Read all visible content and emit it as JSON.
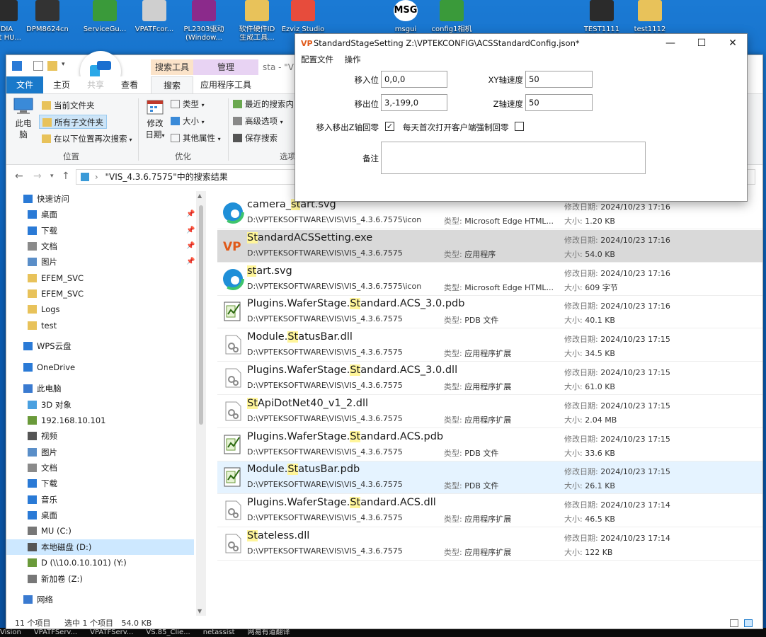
{
  "desktop": {
    "icons": [
      {
        "label": "IDIA",
        "label2": "ont HU...",
        "color": "#2b2b2b"
      },
      {
        "label": "DPM8624cn",
        "label2": "",
        "color": "#333"
      },
      {
        "label": "ServiceGu...",
        "label2": "",
        "color": "#3a9a3a"
      },
      {
        "label": "VPATFcor...",
        "label2": "",
        "color": "#cfcfcf"
      },
      {
        "label": "PL2303驱动",
        "label2": "(Window...",
        "color": "#8b2a8b"
      },
      {
        "label": "软件硬件ID",
        "label2": "生成工具...",
        "color": "#e8c25a"
      },
      {
        "label": "Ezviz Studio",
        "label2": "",
        "color": "#e74c3c"
      },
      {
        "label": "msgui",
        "label2": "",
        "color": "#ffffff"
      },
      {
        "label": "config1相机",
        "label2": "",
        "color": "#3a9a3a"
      },
      {
        "label": "TEST1111",
        "label2": "",
        "color": "#2b2b2b"
      },
      {
        "label": "test1112",
        "label2": "",
        "color": "#e8c25a"
      }
    ],
    "msg_badge": "MSG",
    "taskbar_items": [
      "Vision",
      "VPATFServ...",
      "VPATFServ...",
      "VS.85_Clie...",
      "netassist",
      "网易有道翻译"
    ]
  },
  "explorer": {
    "context_tabs": {
      "search_tools": "搜索工具",
      "manage": "管理",
      "title_fragment": "sta - \"V"
    },
    "tabs": {
      "file": "文件",
      "home": "主页",
      "share": "共享",
      "view": "查看",
      "search": "搜索",
      "app_tools": "应用程序工具"
    },
    "ribbon": {
      "this_pc_line1": "此电",
      "this_pc_line2": "脑",
      "current_folder": "当前文件夹",
      "all_subfolders": "所有子文件夹",
      "search_again": "在以下位置再次搜索",
      "group_location": "位置",
      "date_modified_line1": "修改",
      "date_modified_line2": "日期",
      "kind": "类型",
      "size": "大小",
      "other_props": "其他属性",
      "group_refine": "优化",
      "recent_searches": "最近的搜索内",
      "advanced": "高级选项",
      "save_search": "保存搜索",
      "group_options": "选项"
    },
    "address": "\"VIS_4.3.6.7575\"中的搜索结果",
    "nav": [
      {
        "label": "快速访问",
        "indent": 0,
        "color": "#2a7ad6",
        "pin": false
      },
      {
        "label": "桌面",
        "indent": 1,
        "color": "#2a7ad6",
        "pin": true
      },
      {
        "label": "下载",
        "indent": 1,
        "color": "#2a7ad6",
        "pin": true
      },
      {
        "label": "文档",
        "indent": 1,
        "color": "#8a8a8a",
        "pin": true
      },
      {
        "label": "图片",
        "indent": 1,
        "color": "#5a8ec8",
        "pin": true
      },
      {
        "label": "EFEM_SVC",
        "indent": 1,
        "color": "#e8c25a",
        "pin": false
      },
      {
        "label": "EFEM_SVC",
        "indent": 1,
        "color": "#e8c25a",
        "pin": false
      },
      {
        "label": "Logs",
        "indent": 1,
        "color": "#e8c25a",
        "pin": false
      },
      {
        "label": "test",
        "indent": 1,
        "color": "#e8c25a",
        "pin": false
      },
      {
        "label": "WPS云盘",
        "indent": 0,
        "color": "#2a7ad6",
        "pin": false
      },
      {
        "label": "OneDrive",
        "indent": 0,
        "color": "#2a7ad6",
        "pin": false
      },
      {
        "label": "此电脑",
        "indent": 0,
        "color": "#3a7ad0",
        "pin": false
      },
      {
        "label": "3D 对象",
        "indent": 1,
        "color": "#4aa0e0",
        "pin": false
      },
      {
        "label": "192.168.10.101",
        "indent": 1,
        "color": "#6a9a3a",
        "pin": false
      },
      {
        "label": "视频",
        "indent": 1,
        "color": "#555",
        "pin": false
      },
      {
        "label": "图片",
        "indent": 1,
        "color": "#5a8ec8",
        "pin": false
      },
      {
        "label": "文档",
        "indent": 1,
        "color": "#8a8a8a",
        "pin": false
      },
      {
        "label": "下载",
        "indent": 1,
        "color": "#2a7ad6",
        "pin": false
      },
      {
        "label": "音乐",
        "indent": 1,
        "color": "#2a7ad6",
        "pin": false
      },
      {
        "label": "桌面",
        "indent": 1,
        "color": "#2a7ad6",
        "pin": false
      },
      {
        "label": "MU (C:)",
        "indent": 1,
        "color": "#777",
        "pin": false
      },
      {
        "label": "本地磁盘 (D:)",
        "indent": 1,
        "color": "#555",
        "pin": false,
        "selected": true
      },
      {
        "label": "D (\\\\10.0.10.101) (Y:)",
        "indent": 1,
        "color": "#6a9a3a",
        "pin": false
      },
      {
        "label": "新加卷 (Z:)",
        "indent": 1,
        "color": "#777",
        "pin": false
      },
      {
        "label": "网络",
        "indent": 0,
        "color": "#3a7ad0",
        "pin": false
      }
    ],
    "labels": {
      "date_modified": "修改日期:",
      "type": "类型:",
      "size": "大小:"
    },
    "files": [
      {
        "pre": "camera_",
        "hl": "st",
        "post": "art.svg",
        "path": "D:\\VPTEKSOFTWARE\\VIS\\VIS_4.3.6.7575\\icon",
        "type": "Microsoft Edge HTML...",
        "date": "2024/10/23 17:16",
        "size": "1.20 KB",
        "icon": "edge"
      },
      {
        "pre": "",
        "hl": "St",
        "post": "andardACSSetting.exe",
        "path": "D:\\VPTEKSOFTWARE\\VIS\\VIS_4.3.6.7575",
        "type": "应用程序",
        "date": "2024/10/23 17:16",
        "size": "54.0 KB",
        "icon": "vp",
        "selected": true
      },
      {
        "pre": "",
        "hl": "st",
        "post": "art.svg",
        "path": "D:\\VPTEKSOFTWARE\\VIS\\VIS_4.3.6.7575\\icon",
        "type": "Microsoft Edge HTML...",
        "date": "2024/10/23 17:16",
        "size": "609 字节",
        "icon": "edge"
      },
      {
        "pre": "Plugins.WaferStage.",
        "hl": "St",
        "post": "andard.ACS_3.0.pdb",
        "path": "D:\\VPTEKSOFTWARE\\VIS\\VIS_4.3.6.7575",
        "type": "PDB 文件",
        "date": "2024/10/23 17:16",
        "size": "40.1 KB",
        "icon": "pdb"
      },
      {
        "pre": "Module.",
        "hl": "St",
        "post": "atusBar.dll",
        "path": "D:\\VPTEKSOFTWARE\\VIS\\VIS_4.3.6.7575",
        "type": "应用程序扩展",
        "date": "2024/10/23 17:15",
        "size": "34.5 KB",
        "icon": "dll"
      },
      {
        "pre": "Plugins.WaferStage.",
        "hl": "St",
        "post": "andard.ACS_3.0.dll",
        "path": "D:\\VPTEKSOFTWARE\\VIS\\VIS_4.3.6.7575",
        "type": "应用程序扩展",
        "date": "2024/10/23 17:15",
        "size": "61.0 KB",
        "icon": "dll"
      },
      {
        "pre": "",
        "hl": "St",
        "post": "ApiDotNet40_v1_2.dll",
        "path": "D:\\VPTEKSOFTWARE\\VIS\\VIS_4.3.6.7575",
        "type": "应用程序扩展",
        "date": "2024/10/23 17:15",
        "size": "2.04 MB",
        "icon": "dll"
      },
      {
        "pre": "Plugins.WaferStage.",
        "hl": "St",
        "post": "andard.ACS.pdb",
        "path": "D:\\VPTEKSOFTWARE\\VIS\\VIS_4.3.6.7575",
        "type": "PDB 文件",
        "date": "2024/10/23 17:15",
        "size": "33.6 KB",
        "icon": "pdb"
      },
      {
        "pre": "Module.",
        "hl": "St",
        "post": "atusBar.pdb",
        "path": "D:\\VPTEKSOFTWARE\\VIS\\VIS_4.3.6.7575",
        "type": "PDB 文件",
        "date": "2024/10/23 17:15",
        "size": "26.1 KB",
        "icon": "pdb",
        "hover": true
      },
      {
        "pre": "Plugins.WaferStage.",
        "hl": "St",
        "post": "andard.ACS.dll",
        "path": "D:\\VPTEKSOFTWARE\\VIS\\VIS_4.3.6.7575",
        "type": "应用程序扩展",
        "date": "2024/10/23 17:14",
        "size": "46.5 KB",
        "icon": "dll"
      },
      {
        "pre": "",
        "hl": "St",
        "post": "ateless.dll",
        "path": "D:\\VPTEKSOFTWARE\\VIS\\VIS_4.3.6.7575",
        "type": "应用程序扩展",
        "date": "2024/10/23 17:14",
        "size": "122 KB",
        "icon": "dll"
      }
    ],
    "status": {
      "count": "11 个项目",
      "selected": "选中 1 个项目",
      "size": "54.0 KB"
    }
  },
  "dialog": {
    "logo": "VP",
    "title": "StandardStageSetting Z:\\VPTEKCONFIG\\ACSStandardConfig.json*",
    "menu": {
      "config_file": "配置文件",
      "operate": "操作"
    },
    "fields": {
      "move_in_label": "移入位",
      "move_in_value": "0,0,0",
      "move_out_label": "移出位",
      "move_out_value": "3,-199,0",
      "xy_speed_label": "XY轴速度",
      "xy_speed_value": "50",
      "z_speed_label": "Z轴速度",
      "z_speed_value": "50",
      "z_home_label": "移入移出Z轴回零",
      "z_home_checked": "✓",
      "force_home_label": "每天首次打开客户端强制回零",
      "remark_label": "备注"
    },
    "buttons": {
      "minimize": "—",
      "maximize": "☐",
      "close": "✕"
    }
  }
}
